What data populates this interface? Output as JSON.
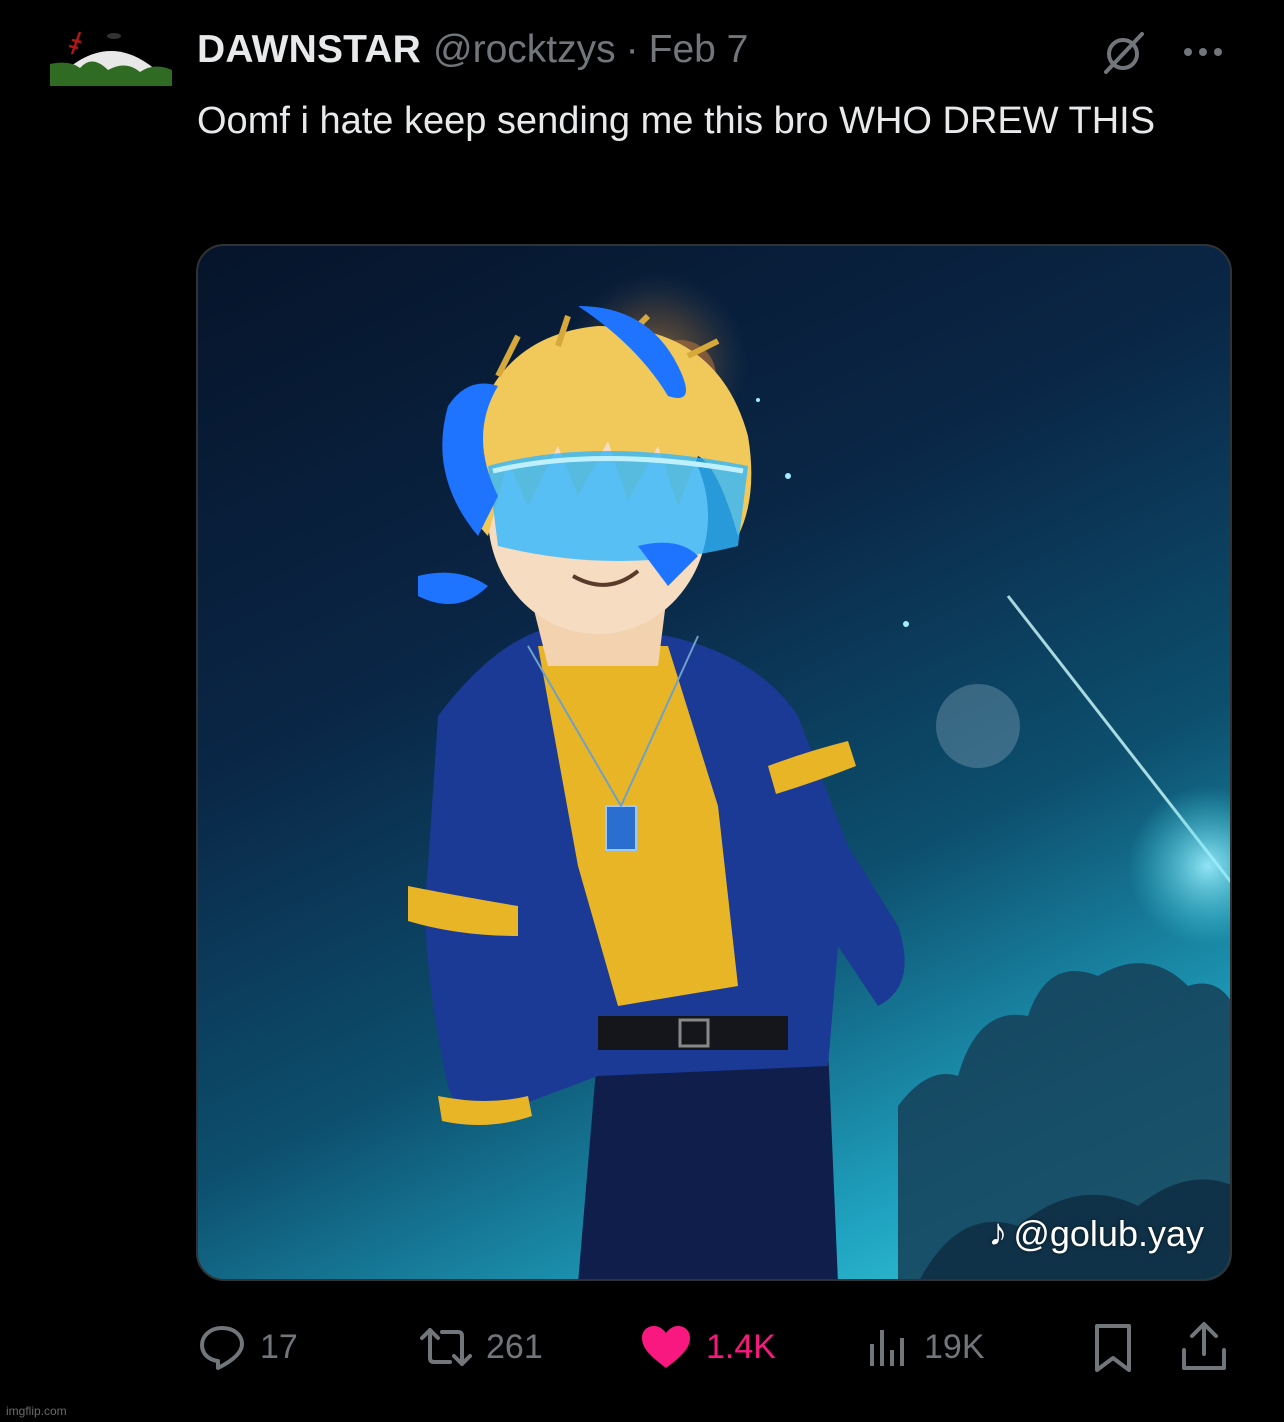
{
  "tweet": {
    "display_name": "DAWNSTAR",
    "handle": "@rocktzys",
    "separator": "·",
    "date": "Feb 7",
    "text": "Oomf i hate keep sending me this bro WHO DREW THIS"
  },
  "media": {
    "watermark_handle": "@golub.yay",
    "watermark_icon": "tiktok-icon"
  },
  "actions": {
    "replies": "17",
    "retweets": "261",
    "likes": "1.4K",
    "views": "19K"
  },
  "colors": {
    "background": "#000000",
    "text": "#e7e9ea",
    "muted": "#71767b",
    "like": "#f91880"
  },
  "footer": {
    "credit": "imgflip.com"
  }
}
